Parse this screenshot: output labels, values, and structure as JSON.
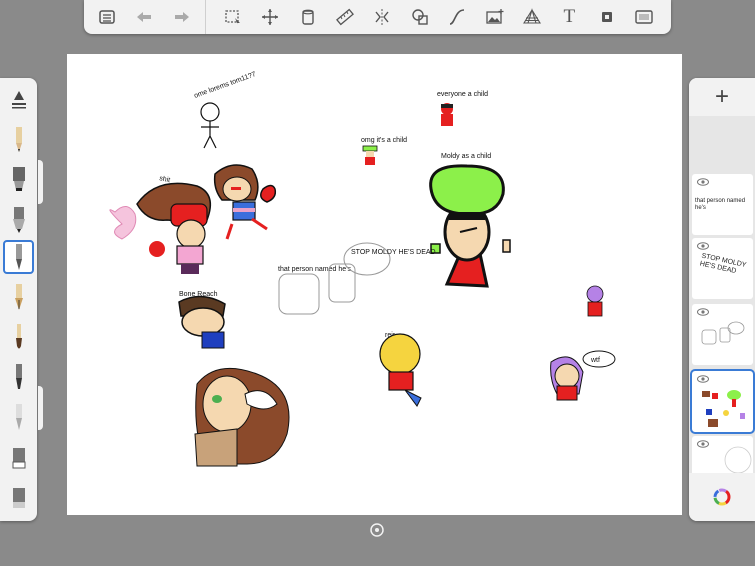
{
  "toolbar": {
    "left_icons": [
      "list-icon",
      "undo-icon",
      "redo-icon"
    ],
    "right_icons": [
      "select-icon",
      "transform-icon",
      "fill-icon",
      "ruler-icon",
      "symmetry-icon",
      "shape-icon",
      "curve-icon",
      "image-icon",
      "perspective-icon",
      "text-icon",
      "stamp-icon",
      "fullscreen-icon"
    ],
    "text_tool_glyph": "T"
  },
  "brushes": {
    "items": [
      "pencil-brush",
      "marker-brush",
      "airbrush-brush",
      "ink-brush",
      "fountain-pen-brush",
      "paint-brush",
      "chisel-brush",
      "soft-brush",
      "eraser-brush",
      "smudge-brush"
    ],
    "selected_index": 3
  },
  "layers": {
    "add_label": "+",
    "items": [
      {
        "name": "layer-blank-top",
        "text": ""
      },
      {
        "name": "layer-that-person",
        "text": "that person named he's"
      },
      {
        "name": "layer-stop-moldy",
        "text": "STOP MOLDY HE'S DEAD"
      },
      {
        "name": "layer-sketch",
        "text": ""
      },
      {
        "name": "layer-main-drawing",
        "text": "",
        "selected": true
      },
      {
        "name": "layer-background",
        "text": ""
      }
    ]
  },
  "canvas_text": {
    "stick_label": "ome lorems tom11?7",
    "everyone_label": "everyone a child",
    "small_label": "omg it's a child",
    "moldy_label": "Moldy as a child",
    "shit_label": "shit",
    "that_person": "that person named he's",
    "stop_moldy": "STOP MOLDY HE'S DEAD",
    "name_tag": "Bone Reach",
    "reir": "reir",
    "wtf": "wtf"
  },
  "colors": {
    "accent": "#3a7bd5",
    "green": "#8cf04a",
    "red": "#e52020",
    "pink": "#ff69b4",
    "brown": "#8b4a2b"
  }
}
